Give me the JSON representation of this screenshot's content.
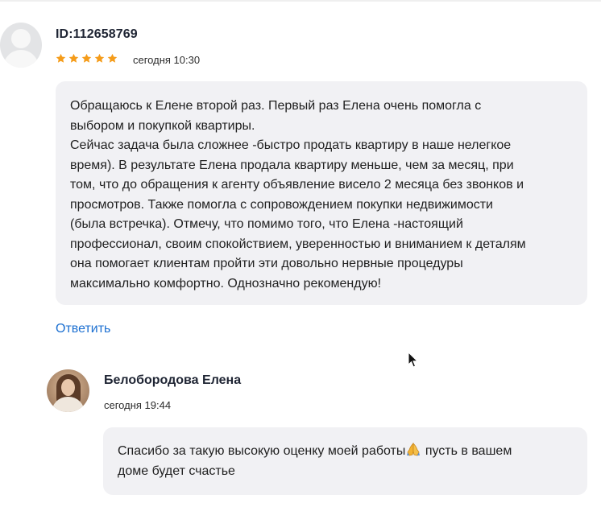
{
  "review": {
    "author_id": "ID:112658769",
    "rating": 5,
    "rating_max": 5,
    "star_color": "#f59c1a",
    "date": "сегодня 10:30",
    "text": "Обращаюсь к Елене второй раз. Первый раз Елена очень помогла с\nвыбором и покупкой квартиры.\nСейчас задача была сложнее -быстро продать квартиру в наше нелегкое\nвремя). В результате Елена продала квартиру меньше, чем за месяц, при\nтом, что до обращения к агенту объявление висело 2 месяца без звонков и\nпросмотров. Также помогла с сопровождением покупки недвижимости\n(была встречка). Отмечу, что помимо того, что Елена -настоящий\nпрофессионал, своим спокойствием, уверенностью и вниманием к деталям\nона помогает клиентам пройти эти довольно нервные процедуры\nмаксимально комфортно. Однозначно рекомендую!"
  },
  "reply_link": "Ответить",
  "reply": {
    "author_name": "Белобородова Елена",
    "date": "сегодня 19:44",
    "text_before_emoji": "Спасибо за такую высокую оценку моей работы",
    "emoji_icon": "folded-hands-icon",
    "text_after_emoji": " пусть в вашем\nдоме будет счастье"
  },
  "colors": {
    "link": "#1b6fd1",
    "bubble_bg": "#f1f1f4"
  }
}
